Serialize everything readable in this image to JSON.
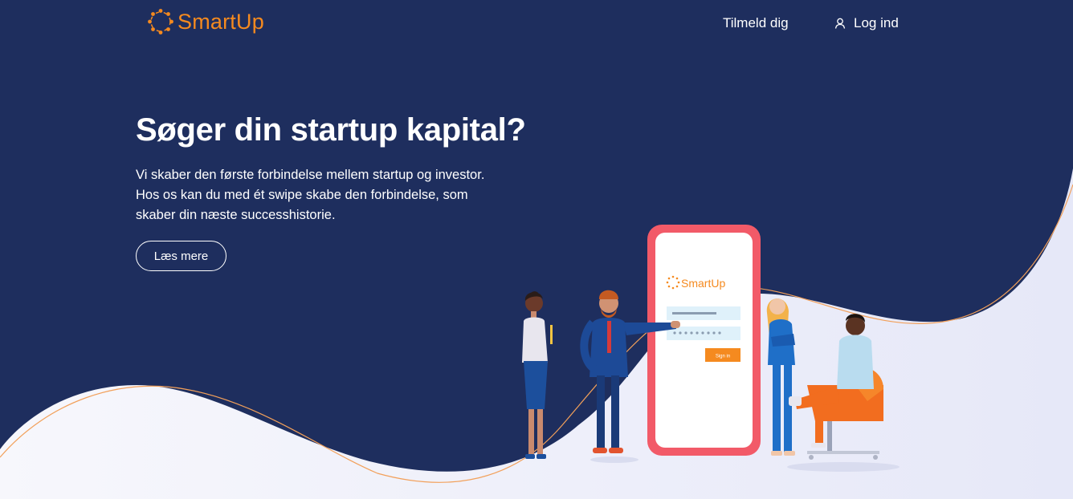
{
  "header": {
    "brand": "SmartUp",
    "nav": {
      "signup_label": "Tilmeld dig",
      "login_label": "Log ind"
    },
    "icons": {
      "logo": "smartup-ring-logo",
      "login": "user-icon"
    }
  },
  "hero": {
    "title": "Søger din startup kapital?",
    "lines": [
      "Vi skaber den første forbindelse mellem startup og investor.",
      "Hos os kan du med ét swipe skabe den forbindelse, som",
      "skaber din næste successhistorie."
    ],
    "cta_label": "Læs mere"
  },
  "illustration": {
    "phone_brand": "SmartUp",
    "phone_button_label": "Sign in"
  },
  "colors": {
    "navy": "#1e2e5e",
    "accent_orange": "#f58a1f",
    "phone_frame": "#f25a68",
    "light_bg": "#f4f5fb"
  }
}
